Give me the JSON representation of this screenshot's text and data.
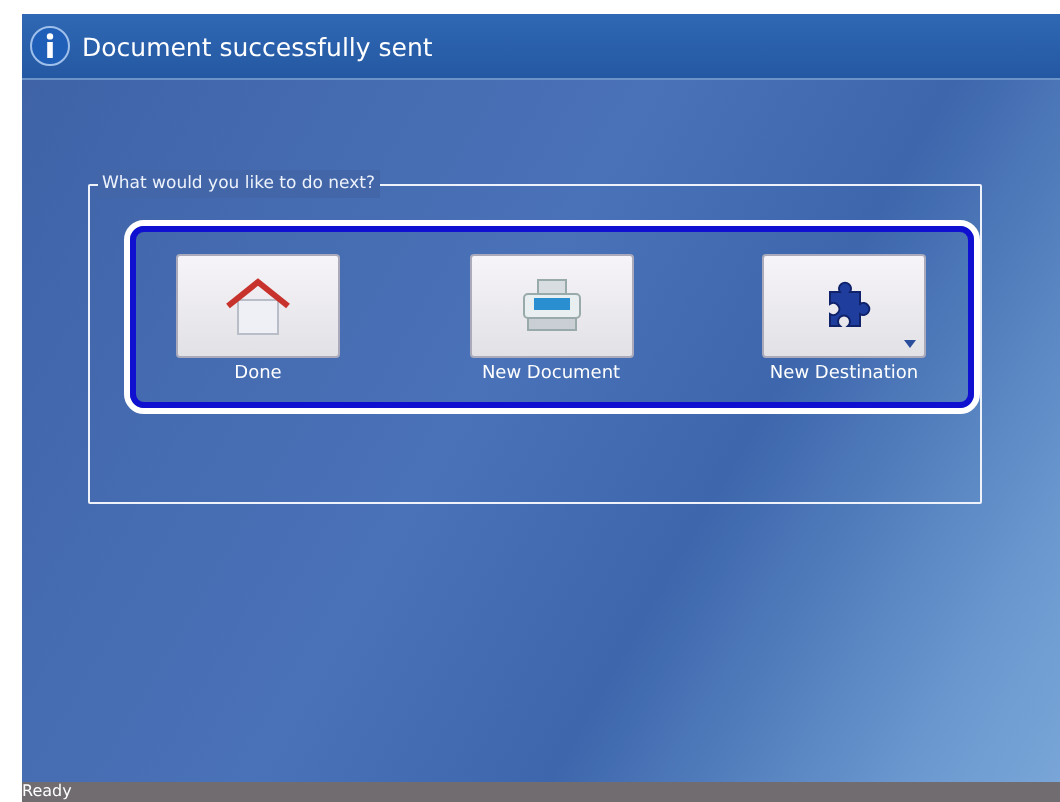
{
  "window": {
    "title": "Document successfully sent"
  },
  "group": {
    "legend": "What would you like to do next?"
  },
  "actions": [
    {
      "kind": "home",
      "label": "Done",
      "has_menu": false
    },
    {
      "kind": "scanner",
      "label": "New Document",
      "has_menu": false
    },
    {
      "kind": "puzzle",
      "label": "New Destination",
      "has_menu": true
    }
  ],
  "status_bar": {
    "text": "Ready"
  }
}
